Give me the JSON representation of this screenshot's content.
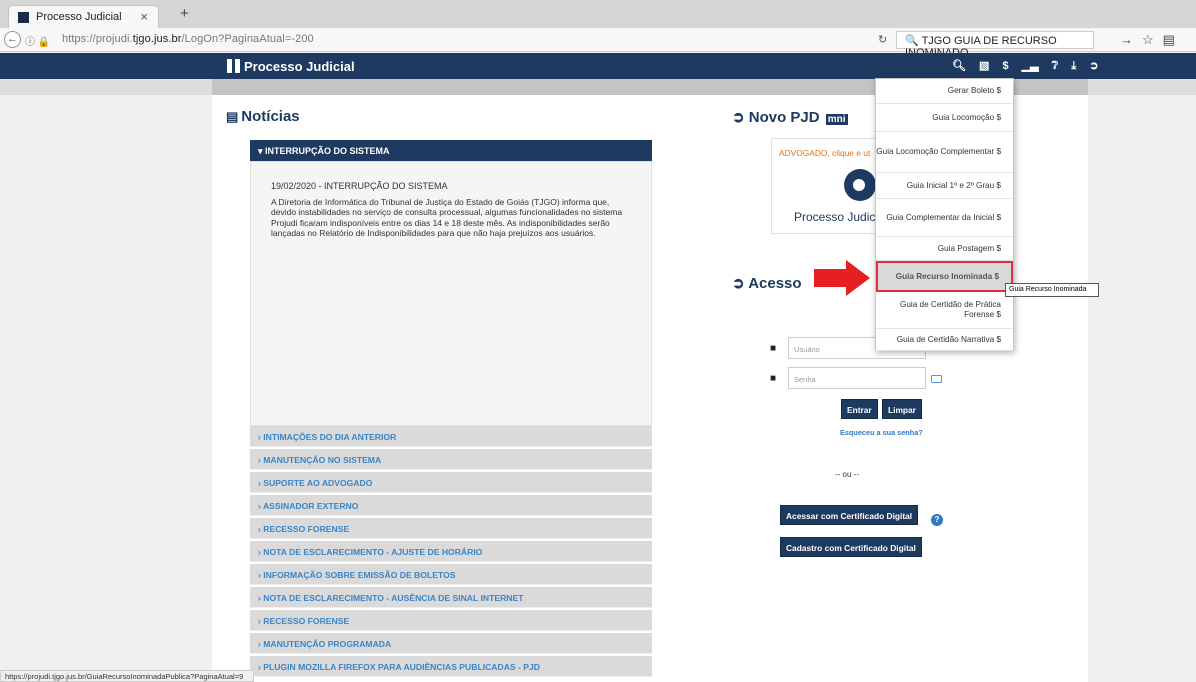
{
  "browser": {
    "tab_title": "Processo Judicial",
    "tab_close": "×",
    "new_tab": "+",
    "url_prefix": "https://projudi.",
    "url_domain": "tjgo.jus.br",
    "url_path": "/LogOn?PaginaAtual=-200",
    "search_text": "TJGO GUIA DE RECURSO INOMINADO"
  },
  "header": {
    "title": "Processo Judicial",
    "icons": [
      "search-icon",
      "document-icon",
      "dollar-icon",
      "chart-icon",
      "help-icon",
      "download-icon",
      "logout-icon"
    ]
  },
  "news": {
    "title": "Notícias",
    "open_item": "INTERRUPÇÃO DO SISTEMA",
    "date_line": "19/02/2020",
    "date_suffix": " - INTERRUPÇÃO DO SISTEMA",
    "body": "A Diretoria de Informática do Tribunal de Justiça do Estado de Goiás (TJGO) informa que, devido instabilidades no serviço de consulta processual, algumas funcionalidades no sistema Projudi ficaram indisponíveis entre os dias 14 e 18 deste mês. As indisponibilidades serão lançadas no Relatório de Indisponibilidades para que não haja prejuízos aos usuários.",
    "items": [
      "INTIMAÇÕES DO DIA ANTERIOR",
      "MANUTENÇÃO NO SISTEMA",
      "SUPORTE AO ADVOGADO",
      "ASSINADOR EXTERNO",
      "RECESSO FORENSE",
      "NOTA DE ESCLARECIMENTO - AJUSTE DE HORÁRIO",
      "INFORMAÇÃO SOBRE EMISSÃO DE BOLETOS",
      "NOTA DE ESCLARECIMENTO - AUSÊNCIA DE SINAL INTERNET",
      "RECESSO FORENSE",
      "MANUTENÇÃO PROGRAMADA",
      "PLUGIN MOZILLA FIREFOX PARA AUDIÊNCIAS PUBLICADAS - PJD"
    ]
  },
  "novo_pjd": {
    "title": "Novo PJD",
    "badge": "mni",
    "advogado_text": "ADVOGADO, clique e ut",
    "logo_text": "Processo Judic"
  },
  "login": {
    "title": "Acesso",
    "user_placeholder": "Usuário",
    "password_placeholder": "Senha",
    "enter": "Entrar",
    "clear": "Limpar",
    "forgot": "Esqueceu a sua senha?",
    "or": "-- ou --",
    "cert_access": "Acessar com Certificado Digital",
    "cert_register": "Cadastro com Certificado Digital"
  },
  "menu": {
    "items": [
      "Gerar Boleto $",
      "Guia Locomoção $",
      "Guia Locomoção Complementar $",
      "Guia Inicial 1º e 2º Grau $",
      "Guia Complementar da Inicial $",
      "Guia Postagem $",
      "Guia Recurso Inominada $",
      "Guia de Certidão de Prática Forense $",
      "Guia de Certidão Narrativa $"
    ],
    "highlighted_index": 6,
    "tooltip": "Guia Recurso Inominada"
  },
  "status_url": "https://projudi.tjgo.jus.br/GuiaRecursoInominadaPublica?PaginaAtual=9",
  "colors": {
    "navy": "#1f3a61",
    "link_blue": "#3c84c6",
    "highlight_red": "#e0303a"
  }
}
